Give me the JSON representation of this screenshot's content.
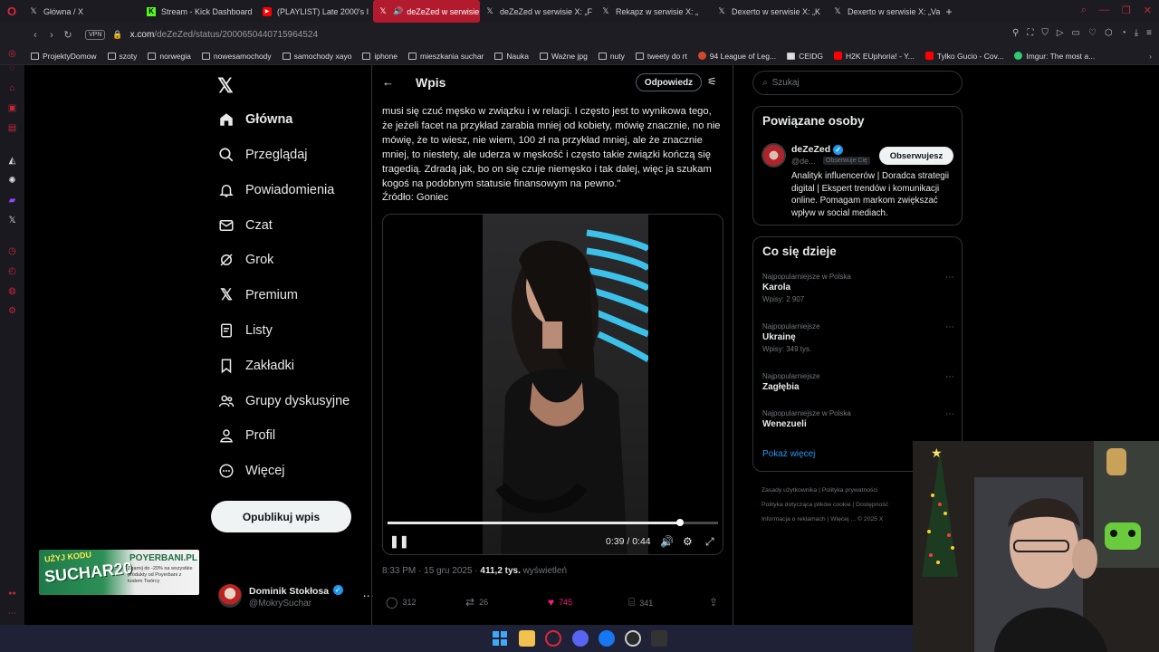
{
  "browser": {
    "tabs": [
      {
        "label": "Główna / X",
        "icon": "x-icon"
      },
      {
        "label": "Stream - Kick Dashboard",
        "icon": "kick-icon"
      },
      {
        "label": "(PLAYLIST) Late 2000's I",
        "icon": "youtube-icon"
      },
      {
        "label": "deZeZed w serwisie",
        "icon": "x-icon",
        "active": true
      },
      {
        "label": "deZeZed w serwisie X: „F",
        "icon": "x-icon"
      },
      {
        "label": "Rekapz w serwisie X: „",
        "icon": "x-icon"
      },
      {
        "label": "Dexerto w serwisie X: „K",
        "icon": "x-icon"
      },
      {
        "label": "Dexerto w serwisie X: „Va",
        "icon": "x-icon"
      }
    ],
    "url_domain": "x.com",
    "url_path": "/deZeZed/status/2000650440715964524",
    "vpn": "VPN",
    "bookmarks": [
      "ProjektyDomow",
      "szoty",
      "norwegia",
      "nowesamochody",
      "samochody xayo",
      "iphone",
      "mieszkania suchar",
      "Nauka",
      "Ważne jpg",
      "nuty",
      "tweety do rt",
      "94 League of Leg...",
      "CEIDG",
      "H2K EUphoria! - Y...",
      "Tylko Gucio - Cov...",
      "Imgur: The most a..."
    ]
  },
  "nav": {
    "items": [
      {
        "label": "Główna",
        "icon": "home-icon"
      },
      {
        "label": "Przeglądaj",
        "icon": "search-icon"
      },
      {
        "label": "Powiadomienia",
        "icon": "bell-icon"
      },
      {
        "label": "Czat",
        "icon": "mail-icon"
      },
      {
        "label": "Grok",
        "icon": "grok-icon"
      },
      {
        "label": "Premium",
        "icon": "x-premium-icon"
      },
      {
        "label": "Listy",
        "icon": "list-icon"
      },
      {
        "label": "Zakładki",
        "icon": "bookmark-icon"
      },
      {
        "label": "Grupy dyskusyjne",
        "icon": "people-icon"
      },
      {
        "label": "Profil",
        "icon": "user-icon"
      },
      {
        "label": "Więcej",
        "icon": "more-circle-icon"
      }
    ],
    "post_button": "Opublikuj wpis",
    "account": {
      "name": "Dominik Stokłosa",
      "handle": "@MokrySuchar"
    }
  },
  "ad": {
    "code_label": "UŻYJ KODU",
    "code": "SUCHAR20",
    "brand": "POYERBANI.PL",
    "text": "Zgarnij do -20% na wszystkie produkty od Poyerbani z kodem Twórcy"
  },
  "post": {
    "header_title": "Wpis",
    "reply_label": "Odpowiedz",
    "text": "musi się czuć męsko w związku i w relacji. I często jest to wynikowa tego, że jeżeli facet na przykład zarabia mniej od kobiety, mówię znacznie, no nie mówię, że to wiesz, nie wiem, 100 zł na przykład mniej, ale że znacznie mniej, to niestety, ale uderza w męskość i często takie związki kończą się tragedią. Zdradą jak, bo on się czuje niemęsko i tak dalej, więc ja szukam kogoś na podobnym statusie finansowym na pewno.\"",
    "source": "Źródło: Goniec",
    "video": {
      "time": "0:39 / 0:44",
      "progress": 0.886,
      "buffered": 0.9
    },
    "timestamp": "8:33 PM · 15 gru 2025 · ",
    "views_count": "411,2 tys.",
    "views_label": " wyświetleń",
    "stats": {
      "replies": "312",
      "reposts": "26",
      "likes": "745",
      "bookmarks": "341"
    }
  },
  "right": {
    "search_placeholder": "Szukaj",
    "related_title": "Powiązane osoby",
    "related": {
      "name": "deZeZed",
      "handle": "@de...",
      "badge": "Obserwuje Cię",
      "follow_label": "Obserwujesz",
      "bio": "Analityk influencerów | Doradca strategii digital | Ekspert trendów i komunikacji online. Pomagam markom zwiększać wpływ w social mediach."
    },
    "trends_title": "Co się dzieje",
    "trends": [
      {
        "category": "Najpopularniejsze w Polska",
        "name": "Karola",
        "posts": "Wpisy: 2 907"
      },
      {
        "category": "Najpopularniejsze",
        "name": "Ukrainę",
        "posts": "Wpisy: 349 tys."
      },
      {
        "category": "Najpopularniejsze",
        "name": "Zagłębia",
        "posts": ""
      },
      {
        "category": "Najpopularniejsze w Polska",
        "name": "Wenezueli",
        "posts": ""
      }
    ],
    "show_more": "Pokaż więcej",
    "footer": [
      "Zasady użytkownika",
      "Polityka prywatności",
      "Polityka dotycząca plików cookie",
      "Dostępność",
      "Informacja o reklamach",
      "Więcej ...",
      "© 2025 X"
    ]
  },
  "colors": {
    "accent": "#1d9bf0",
    "like": "#f91880",
    "active_tab": "#b21a2e",
    "opera_red": "#c8273a"
  }
}
